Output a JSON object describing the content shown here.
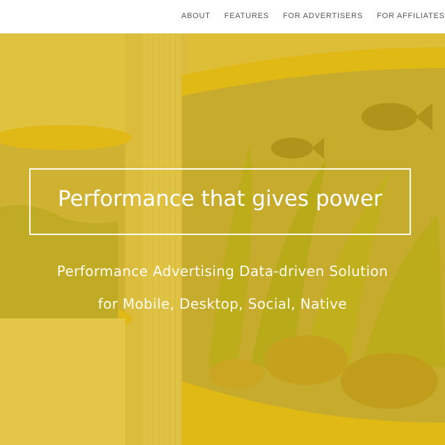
{
  "nav": {
    "items": [
      {
        "label": "ABOUT"
      },
      {
        "label": "FEATURES"
      },
      {
        "label": "FOR ADVERTISERS"
      },
      {
        "label": "FOR AFFILIATES"
      }
    ]
  },
  "hero": {
    "headline": "Performance that gives power",
    "subline_1": "Performance Advertising Data-driven Solution",
    "subline_2": "for Mobile, Desktop, Social, Native",
    "overlay_color": "#dfb914"
  }
}
